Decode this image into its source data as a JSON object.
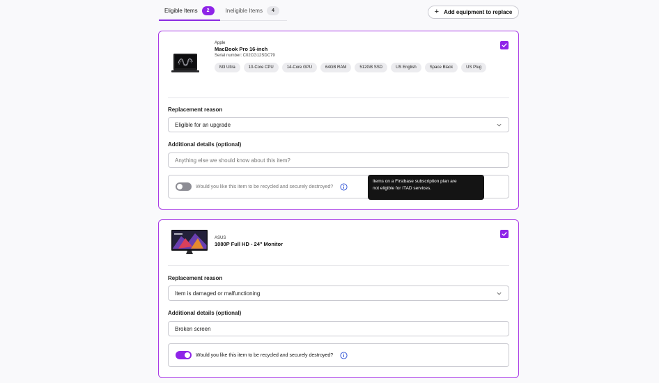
{
  "tabs": [
    {
      "label": "Eligible Items",
      "count": "2"
    },
    {
      "label": "Ineligible Items",
      "count": "4"
    }
  ],
  "add_button_label": "Add equipment to replace",
  "items": [
    {
      "brand": "Apple",
      "model": "MacBook Pro 16-inch",
      "serial": "Serial number: C02CG12SDC79",
      "specs": [
        "M3 Ultra",
        "10-Core CPU",
        "14-Core GPU",
        "64GB RAM",
        "512GB SSD",
        "US English",
        "Space Black",
        "US Plug"
      ],
      "replacement_reason_label": "Replacement reason",
      "replacement_reason_value": "Eligible for an upgrade",
      "details_label": "Additional details (optional)",
      "details_placeholder": "Anything else we should know about this item?",
      "recycle_question": "Would you like this item to be recycled and securely destroyed?",
      "recycle_enabled": false,
      "selected": true
    },
    {
      "brand": "ASUS",
      "model": "1080P Full HD - 24\" Monitor",
      "replacement_reason_label": "Replacement reason",
      "replacement_reason_value": "Item is damaged or malfunctioning",
      "details_label": "Additional details (optional)",
      "details_value": "Broken screen",
      "recycle_question": "Would you like this item to be recycled and securely destroyed?",
      "recycle_enabled": true,
      "selected": true
    }
  ],
  "tooltip": {
    "line1": "Items on a Firstbase subscription plan are",
    "line2": "not eligible for ITAD services."
  },
  "colors": {
    "accent": "#8e24e8",
    "card_border": "#a93be6",
    "tooltip_bg": "#141414"
  }
}
